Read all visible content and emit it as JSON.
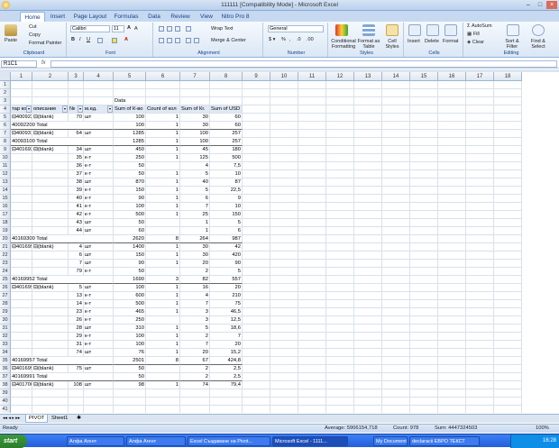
{
  "window": {
    "title": "111111  [Compatibility Mode] - Microsoft Excel"
  },
  "ribbon_tabs": [
    "Home",
    "Insert",
    "Page Layout",
    "Formulas",
    "Data",
    "Review",
    "View",
    "Nitro Pro 8"
  ],
  "clipboard": {
    "paste": "Paste",
    "cut": "Cut",
    "copy": "Copy",
    "format_painter": "Format Painter",
    "label": "Clipboard"
  },
  "font": {
    "name": "Calibri",
    "size": "11",
    "label": "Font"
  },
  "alignment": {
    "wrap": "Wrap Text",
    "merge": "Merge & Center",
    "label": "Alignment"
  },
  "number": {
    "format": "General",
    "label": "Number"
  },
  "styles": {
    "conditional": "Conditional Formatting",
    "format_table": "Format as Table",
    "cell_styles": "Cell Styles",
    "label": "Styles"
  },
  "cells": {
    "insert": "Insert",
    "delete": "Delete",
    "format": "Format",
    "label": "Cells"
  },
  "editing": {
    "autosum": "AutoSum",
    "fill": "Fill",
    "clear": "Clear",
    "sort": "Sort & Filter",
    "find": "Find & Select",
    "label": "Editing"
  },
  "formula_bar": {
    "name_box": "R1C1",
    "fx": "fx",
    "value": ""
  },
  "columns": [
    "1",
    "2",
    "3",
    "4",
    "5",
    "6",
    "7",
    "8",
    "9",
    "10",
    "11",
    "12",
    "13",
    "14",
    "15",
    "16",
    "17",
    "18"
  ],
  "header_data": "Data",
  "headers": [
    "тар код",
    "описание",
    "№",
    "м.ед.",
    "Sum of К-во",
    "Count of кол",
    "Sum of Кг.",
    "Sum of  USD"
  ],
  "rows": [
    [
      "40092200",
      "(blank)",
      "70",
      "шт",
      "100",
      "1",
      "30",
      "60"
    ],
    [
      "40092200 Total",
      "",
      "",
      "",
      "100",
      "1",
      "30",
      "60"
    ],
    [
      "40093100",
      "(blank)",
      "64",
      "шт",
      "1285",
      "1",
      "100",
      "257"
    ],
    [
      "40093100 Total",
      "",
      "",
      "",
      "1285",
      "1",
      "100",
      "257"
    ],
    [
      "40169300",
      "(blank)",
      "34",
      "шт",
      "450",
      "1",
      "45",
      "180"
    ],
    [
      "",
      "",
      "35",
      "к-т",
      "250",
      "1",
      "125",
      "500"
    ],
    [
      "",
      "",
      "36",
      "к-т",
      "50",
      "",
      "4",
      "7,5"
    ],
    [
      "",
      "",
      "37",
      "к-т",
      "50",
      "1",
      "5",
      "10"
    ],
    [
      "",
      "",
      "38",
      "шт",
      "870",
      "1",
      "40",
      "87"
    ],
    [
      "",
      "",
      "39",
      "к-т",
      "150",
      "1",
      "5",
      "22,5"
    ],
    [
      "",
      "",
      "40",
      "к-т",
      "90",
      "1",
      "6",
      "9"
    ],
    [
      "",
      "",
      "41",
      "к-т",
      "100",
      "1",
      "7",
      "10"
    ],
    [
      "",
      "",
      "42",
      "к-т",
      "500",
      "1",
      "25",
      "150"
    ],
    [
      "",
      "",
      "43",
      "шт",
      "50",
      "",
      "1",
      "5"
    ],
    [
      "",
      "",
      "44",
      "шт",
      "60",
      "",
      "1",
      "6"
    ],
    [
      "40169300 Total",
      "",
      "",
      "",
      "2620",
      "8",
      "264",
      "987"
    ],
    [
      "40169952",
      "(blank)",
      "4",
      "шт",
      "1400",
      "1",
      "30",
      "42"
    ],
    [
      "",
      "",
      "6",
      "шт",
      "150",
      "1",
      "30",
      "420"
    ],
    [
      "",
      "",
      "7",
      "шт",
      "90",
      "1",
      "20",
      "90"
    ],
    [
      "",
      "",
      "79",
      "к-т",
      "50",
      "",
      "2",
      "5"
    ],
    [
      "40169952 Total",
      "",
      "",
      "",
      "1690",
      "3",
      "82",
      "557"
    ],
    [
      "40169957",
      "(blank)",
      "5",
      "шт",
      "100",
      "1",
      "16",
      "20"
    ],
    [
      "",
      "",
      "13",
      "к-т",
      "600",
      "1",
      "4",
      "210"
    ],
    [
      "",
      "",
      "14",
      "к-т",
      "500",
      "1",
      "7",
      "75"
    ],
    [
      "",
      "",
      "23",
      "к-т",
      "465",
      "1",
      "3",
      "46,5"
    ],
    [
      "",
      "",
      "26",
      "к-т",
      "250",
      "",
      "3",
      "12,5"
    ],
    [
      "",
      "",
      "28",
      "шт",
      "310",
      "1",
      "5",
      "18,6"
    ],
    [
      "",
      "",
      "29",
      "к-т",
      "100",
      "1",
      "2",
      "7"
    ],
    [
      "",
      "",
      "31",
      "к-т",
      "100",
      "1",
      "7",
      "20"
    ],
    [
      "",
      "",
      "74",
      "шт",
      "76",
      "1",
      "20",
      "15,2"
    ],
    [
      "40169957 Total",
      "",
      "",
      "",
      "2501",
      "8",
      "67",
      "424,8"
    ],
    [
      "40169991",
      "(blank)",
      "75",
      "шт",
      "50",
      "",
      "2",
      "2,5"
    ],
    [
      "40169991 Total",
      "",
      "",
      "",
      "50",
      "",
      "2",
      "2,5"
    ],
    [
      "40170000",
      "(blank)",
      "108",
      "шт",
      "98",
      "1",
      "74",
      "79,4"
    ]
  ],
  "sheets": [
    "PIVOT",
    "Sheet1"
  ],
  "status": {
    "ready": "Ready",
    "average": "Average: 5906154,718",
    "count": "Count: 978",
    "sum": "Sum: 4447324503",
    "zoom": "100%"
  },
  "taskbar": {
    "start": "start",
    "buttons": [
      "Алфа Агент",
      "Алфа Агент",
      "Excel Създаване на Pivot...",
      "Microsoft Excel - 1111...",
      "My Documents",
      "declaracii ЕВРО ТЕКСТ"
    ],
    "clock": "16:28"
  }
}
